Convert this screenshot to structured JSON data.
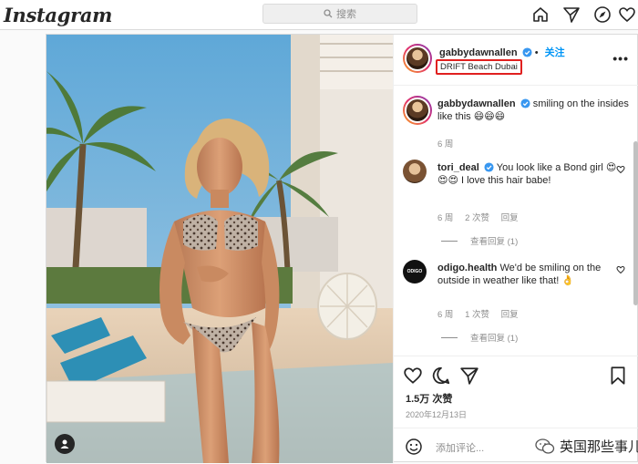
{
  "app": {
    "logo": "Instagram"
  },
  "search": {
    "placeholder": "搜索"
  },
  "nav": {
    "icons": [
      "home-icon",
      "direct-icon",
      "explore-icon",
      "activity-icon"
    ]
  },
  "post": {
    "author": {
      "username": "gabbydawnallen",
      "verified": true,
      "follow_label": "关注",
      "location": "DRIFT Beach Dubai"
    },
    "caption": {
      "username": "gabbydawnallen",
      "text": "smiling on the insides like this",
      "emojis": "😄😄😄",
      "time": "6 周"
    },
    "comments": [
      {
        "username": "tori_deal",
        "text_line1": "You look like a Bond",
        "text_line2": "girl",
        "emojis": "😍😍😍",
        "text_line2b": "I love this hair",
        "text_line3": "babe!",
        "time": "6 周",
        "likes": "2 次赞",
        "reply": "回复",
        "view_replies": "查看回复 (1)"
      },
      {
        "username": "odigo.health",
        "text_line1": "We'd be smiling on",
        "text_line2": "the outside in weather like that!",
        "emoji": "👌",
        "time": "6 周",
        "likes": "1 次赞",
        "reply": "回复",
        "view_replies": "查看回复 (1)"
      }
    ],
    "likes_count": "1.5万 次赞",
    "date": "2020年12月13日",
    "add_comment_placeholder": "添加评论...",
    "watermark": "英国那些事儿"
  }
}
